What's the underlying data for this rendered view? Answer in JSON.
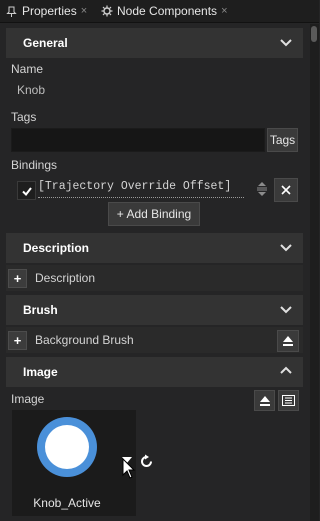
{
  "tabs": [
    {
      "label": "Properties",
      "close": "×"
    },
    {
      "label": "Node Components",
      "close": "×"
    }
  ],
  "general": {
    "header": "General",
    "name_label": "Name",
    "name_value": "Knob",
    "tags_label": "Tags",
    "tags_value": "",
    "tags_button": "Tags",
    "bindings_label": "Bindings",
    "binding_value": "[Trajectory Override Offset]",
    "add_binding_label": "+ Add Binding"
  },
  "description": {
    "header": "Description",
    "item_label": "Description"
  },
  "brush": {
    "header": "Brush",
    "item_label": "Background Brush"
  },
  "image": {
    "header": "Image",
    "label": "Image",
    "preview_name": "Knob_Active"
  },
  "colors": {
    "accent_blue": "#4a90d9",
    "section_bg": "#333333",
    "panel_bg": "#252526"
  }
}
